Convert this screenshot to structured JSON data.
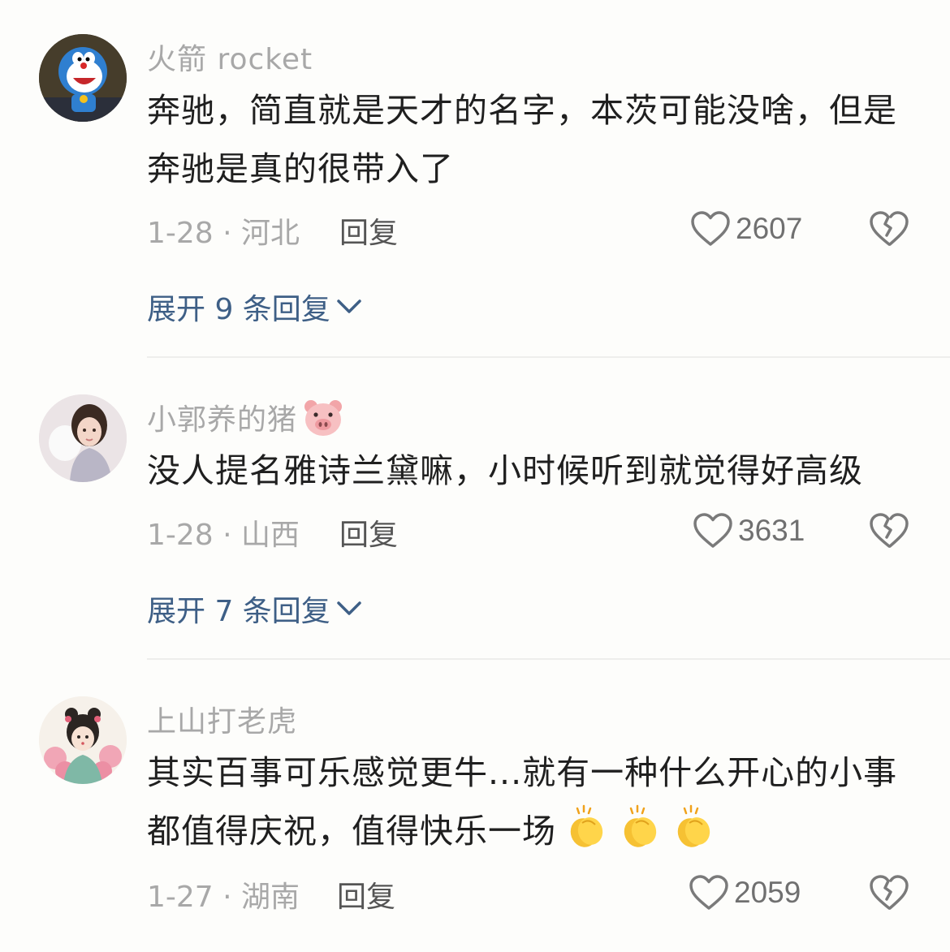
{
  "comments": [
    {
      "username": "火箭 rocket",
      "text": "奔驰，简直就是天才的名字，本茨可能没啥，但是奔驰是真的很带入了",
      "date_location": "1-28 · 河北",
      "reply_label": "回复",
      "likes": "2607",
      "expand_label": "展开 9 条回复"
    },
    {
      "username": "小郭养的猪",
      "text": "没人提名雅诗兰黛嘛，小时候听到就觉得好高级",
      "date_location": "1-28 · 山西",
      "reply_label": "回复",
      "likes": "3631",
      "expand_label": "展开 7 条回复"
    },
    {
      "username": "上山打老虎",
      "text": "其实百事可乐感觉更牛...就有一种什么开心的小事都值得庆祝，值得快乐一场",
      "date_location": "1-27 · 湖南",
      "reply_label": "回复",
      "likes": "2059"
    }
  ],
  "colors": {
    "background": "#fdfdfb",
    "username": "#a8a8a8",
    "expand_link": "#3e5f86",
    "divider": "#eeeeec"
  },
  "icons": {
    "like": "heart-outline-icon",
    "dislike": "broken-heart-icon",
    "expand": "chevron-down-icon",
    "username_emoji": "pig-face-emoji",
    "text_emoji": "clapping-hands-emoji"
  }
}
